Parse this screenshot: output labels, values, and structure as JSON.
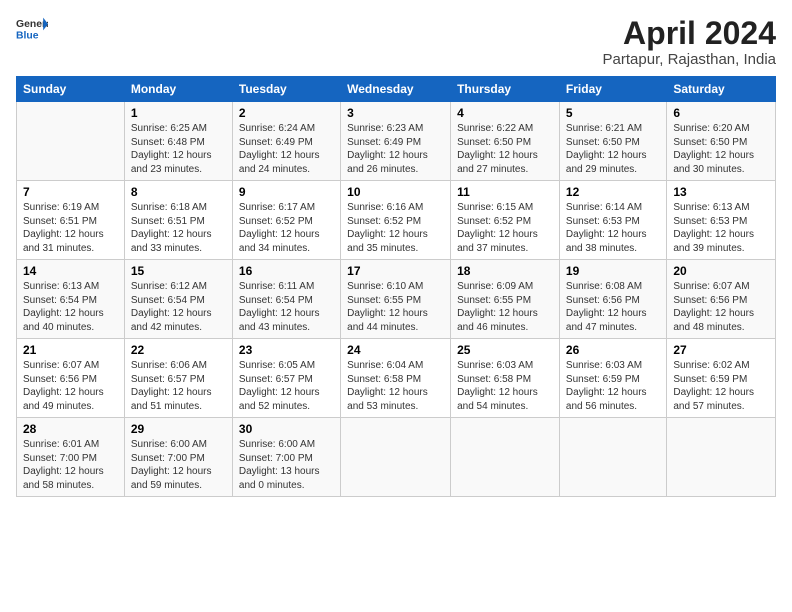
{
  "header": {
    "logo_line1": "General",
    "logo_line2": "Blue",
    "title": "April 2024",
    "subtitle": "Partapur, Rajasthan, India"
  },
  "columns": [
    "Sunday",
    "Monday",
    "Tuesday",
    "Wednesday",
    "Thursday",
    "Friday",
    "Saturday"
  ],
  "rows": [
    [
      {
        "num": "",
        "info": ""
      },
      {
        "num": "1",
        "info": "Sunrise: 6:25 AM\nSunset: 6:48 PM\nDaylight: 12 hours\nand 23 minutes."
      },
      {
        "num": "2",
        "info": "Sunrise: 6:24 AM\nSunset: 6:49 PM\nDaylight: 12 hours\nand 24 minutes."
      },
      {
        "num": "3",
        "info": "Sunrise: 6:23 AM\nSunset: 6:49 PM\nDaylight: 12 hours\nand 26 minutes."
      },
      {
        "num": "4",
        "info": "Sunrise: 6:22 AM\nSunset: 6:50 PM\nDaylight: 12 hours\nand 27 minutes."
      },
      {
        "num": "5",
        "info": "Sunrise: 6:21 AM\nSunset: 6:50 PM\nDaylight: 12 hours\nand 29 minutes."
      },
      {
        "num": "6",
        "info": "Sunrise: 6:20 AM\nSunset: 6:50 PM\nDaylight: 12 hours\nand 30 minutes."
      }
    ],
    [
      {
        "num": "7",
        "info": "Sunrise: 6:19 AM\nSunset: 6:51 PM\nDaylight: 12 hours\nand 31 minutes."
      },
      {
        "num": "8",
        "info": "Sunrise: 6:18 AM\nSunset: 6:51 PM\nDaylight: 12 hours\nand 33 minutes."
      },
      {
        "num": "9",
        "info": "Sunrise: 6:17 AM\nSunset: 6:52 PM\nDaylight: 12 hours\nand 34 minutes."
      },
      {
        "num": "10",
        "info": "Sunrise: 6:16 AM\nSunset: 6:52 PM\nDaylight: 12 hours\nand 35 minutes."
      },
      {
        "num": "11",
        "info": "Sunrise: 6:15 AM\nSunset: 6:52 PM\nDaylight: 12 hours\nand 37 minutes."
      },
      {
        "num": "12",
        "info": "Sunrise: 6:14 AM\nSunset: 6:53 PM\nDaylight: 12 hours\nand 38 minutes."
      },
      {
        "num": "13",
        "info": "Sunrise: 6:13 AM\nSunset: 6:53 PM\nDaylight: 12 hours\nand 39 minutes."
      }
    ],
    [
      {
        "num": "14",
        "info": "Sunrise: 6:13 AM\nSunset: 6:54 PM\nDaylight: 12 hours\nand 40 minutes."
      },
      {
        "num": "15",
        "info": "Sunrise: 6:12 AM\nSunset: 6:54 PM\nDaylight: 12 hours\nand 42 minutes."
      },
      {
        "num": "16",
        "info": "Sunrise: 6:11 AM\nSunset: 6:54 PM\nDaylight: 12 hours\nand 43 minutes."
      },
      {
        "num": "17",
        "info": "Sunrise: 6:10 AM\nSunset: 6:55 PM\nDaylight: 12 hours\nand 44 minutes."
      },
      {
        "num": "18",
        "info": "Sunrise: 6:09 AM\nSunset: 6:55 PM\nDaylight: 12 hours\nand 46 minutes."
      },
      {
        "num": "19",
        "info": "Sunrise: 6:08 AM\nSunset: 6:56 PM\nDaylight: 12 hours\nand 47 minutes."
      },
      {
        "num": "20",
        "info": "Sunrise: 6:07 AM\nSunset: 6:56 PM\nDaylight: 12 hours\nand 48 minutes."
      }
    ],
    [
      {
        "num": "21",
        "info": "Sunrise: 6:07 AM\nSunset: 6:56 PM\nDaylight: 12 hours\nand 49 minutes."
      },
      {
        "num": "22",
        "info": "Sunrise: 6:06 AM\nSunset: 6:57 PM\nDaylight: 12 hours\nand 51 minutes."
      },
      {
        "num": "23",
        "info": "Sunrise: 6:05 AM\nSunset: 6:57 PM\nDaylight: 12 hours\nand 52 minutes."
      },
      {
        "num": "24",
        "info": "Sunrise: 6:04 AM\nSunset: 6:58 PM\nDaylight: 12 hours\nand 53 minutes."
      },
      {
        "num": "25",
        "info": "Sunrise: 6:03 AM\nSunset: 6:58 PM\nDaylight: 12 hours\nand 54 minutes."
      },
      {
        "num": "26",
        "info": "Sunrise: 6:03 AM\nSunset: 6:59 PM\nDaylight: 12 hours\nand 56 minutes."
      },
      {
        "num": "27",
        "info": "Sunrise: 6:02 AM\nSunset: 6:59 PM\nDaylight: 12 hours\nand 57 minutes."
      }
    ],
    [
      {
        "num": "28",
        "info": "Sunrise: 6:01 AM\nSunset: 7:00 PM\nDaylight: 12 hours\nand 58 minutes."
      },
      {
        "num": "29",
        "info": "Sunrise: 6:00 AM\nSunset: 7:00 PM\nDaylight: 12 hours\nand 59 minutes."
      },
      {
        "num": "30",
        "info": "Sunrise: 6:00 AM\nSunset: 7:00 PM\nDaylight: 13 hours\nand 0 minutes."
      },
      {
        "num": "",
        "info": ""
      },
      {
        "num": "",
        "info": ""
      },
      {
        "num": "",
        "info": ""
      },
      {
        "num": "",
        "info": ""
      }
    ]
  ]
}
